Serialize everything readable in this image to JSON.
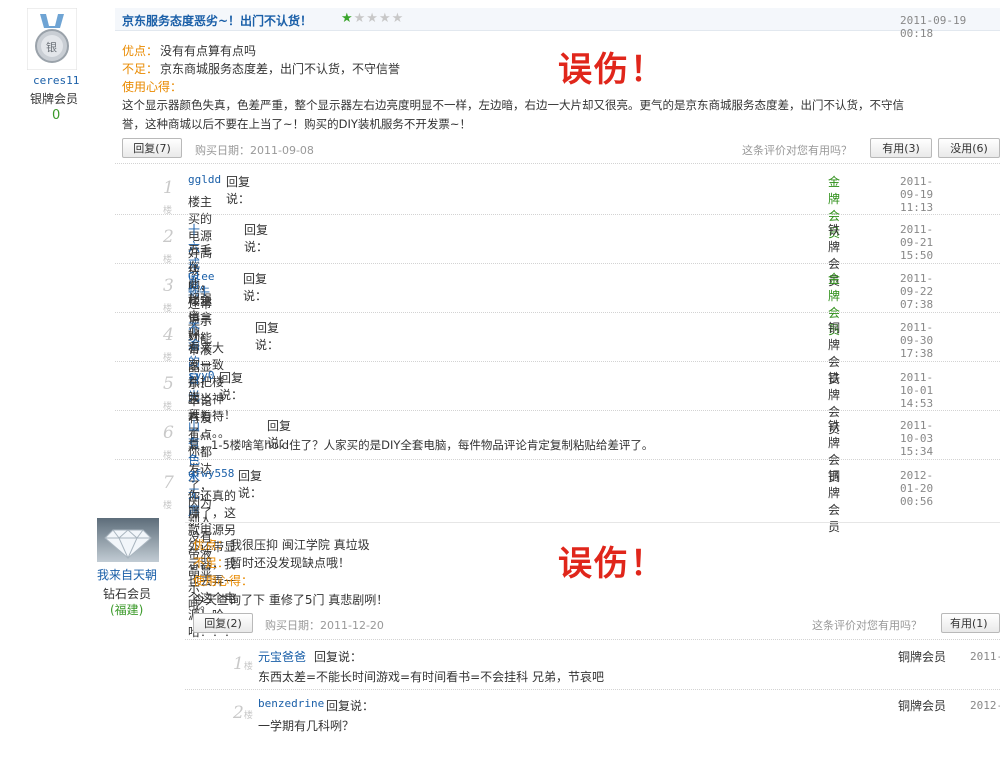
{
  "review1": {
    "user": {
      "name": "ceres11",
      "level": "银牌会员",
      "score": "0",
      "badge_text": "银"
    },
    "title": "京东服务态度恶劣~！出门不认货！",
    "stars": 1,
    "time": "2011-09-19 00:18",
    "pros_label": "优点：",
    "pros": "没有有点算有点吗",
    "cons_label": "不足：",
    "cons": "京东商城服务态度差，出门不认货，不守信誉",
    "exp_label": "使用心得：",
    "exp_line1": "这个显示器颜色失真，色差严重，整个显示器左右边亮度明显不一样，左边暗，右边一大片却又很亮。更气的是京东商城服务态度差，出门不认货，不守信",
    "exp_line2": "誉，这种商城以后不要在上当了~！购买的DIY装机服务不开发票~！",
    "reply_btn": "回复(7)",
    "buy_date": "购买日期：2011-09-08",
    "helpful_q": "这条评价对您有用吗？",
    "useful_btn": "有用(3)",
    "useless_btn": "没用(6)",
    "stamp": "误伤！",
    "replies": [
      {
        "floor": "1",
        "floor_suffix": "楼",
        "user": "ggldd",
        "say": "回复说：",
        "text": "楼主买的电源好高级咧，还带显示功能",
        "rank": "金牌会员",
        "time": "2011-09-19 11:13"
      },
      {
        "floor": "2",
        "floor_suffix": "楼",
        "user": "十六戒贤",
        "say": "回复说：",
        "text": "五毛在此，楼主请拿好。",
        "rank": "铁牌会员",
        "time": "2011-09-21 15:50"
      },
      {
        "floor": "3",
        "floor_suffix": "楼",
        "user": "Glee蜗牛",
        "say": "回复说：",
        "text": "超强电源，带液晶显示！不论有没有点你都发达了，因为别人没有带液晶显示哦。",
        "rank": "金牌会员",
        "time": "2011-09-22 07:38"
      },
      {
        "floor": "4",
        "floor_suffix": "楼",
        "user": "不渝的目光",
        "say": "回复说：",
        "text": "看来大家一致都把楼主当神人看待了。。。。",
        "rank": "铜牌会员",
        "time": "2011-09-30 17:38"
      },
      {
        "floor": "5",
        "floor_suffix": "楼",
        "user": "syy0",
        "say": "回复说：",
        "text": "膜拜！！！",
        "rank": "铁牌会员",
        "time": "2011-10-01 14:53"
      },
      {
        "floor": "6",
        "floor_suffix": "楼",
        "user": "山有色水无声",
        "say": "回复说：",
        "text": "靠，1-5楼啥笔hold住了？人家买的是DIY全套电脑，每件物品评论肯定复制粘贴给差评了。",
        "rank": "铁牌会员",
        "time": "2011-10-03 15:34"
      },
      {
        "floor": "7",
        "floor_suffix": "楼",
        "user": "qfwy558",
        "say": "回复说：",
        "text": "你还真的赚了，这款电源另外还带显示器，我也去弄一个这个电源！哈哈！！！",
        "rank": "铜牌会员",
        "time": "2012-01-20 00:56"
      }
    ]
  },
  "review2": {
    "user": {
      "name": "我来自天朝",
      "level": "钻石会员",
      "region": "(福建)"
    },
    "pros_label": "优点：",
    "pros": "我很压抑 闽江学院 真垃圾",
    "cons_label": "不足：",
    "cons": "暂时还没发现缺点哦！",
    "exp_label": "使用心得：",
    "exp": "今天查询了下 重修了5门 真悲剧咧！",
    "reply_btn": "回复(2)",
    "buy_date": "购买日期：2011-12-20",
    "helpful_q": "这条评价对您有用吗？",
    "useful_btn": "有用(1)",
    "stamp": "误伤！",
    "replies": [
      {
        "floor": "1",
        "floor_suffix": "楼",
        "user": "元宝爸爸",
        "say": "回复说：",
        "text": "东西太差=不能长时间游戏=有时间看书=不会挂科 兄弟，节哀吧",
        "rank": "铜牌会员",
        "time": "2011-"
      },
      {
        "floor": "2",
        "floor_suffix": "楼",
        "user": "benzedrine",
        "say": "回复说：",
        "text": "一学期有几科咧？",
        "rank": "铜牌会员",
        "time": "2012-"
      }
    ]
  },
  "colors": {
    "link": "#1a5fa8",
    "orange": "#e98a00",
    "stamp": "#e0261b",
    "gold": "#2c8e16",
    "star": "#3aa52c"
  }
}
